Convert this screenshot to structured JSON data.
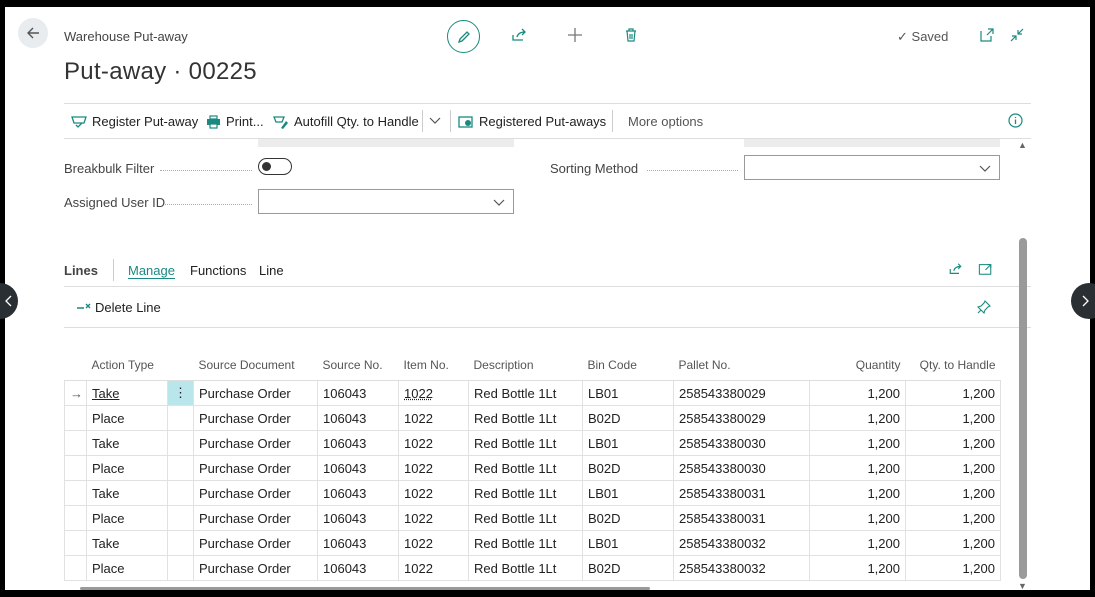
{
  "header": {
    "breadcrumb": "Warehouse Put-away",
    "title": "Put-away · 00225",
    "status": "Saved"
  },
  "toolbar": {
    "register_label": "Register Put-away",
    "print_label": "Print...",
    "autofill_label": "Autofill Qty. to Handle",
    "registered_label": "Registered Put-aways",
    "more_label": "More options"
  },
  "fields": {
    "breakbulk_label": "Breakbulk Filter",
    "assigned_label": "Assigned User ID",
    "sorting_label": "Sorting Method",
    "assigned_value": "",
    "sorting_value": "",
    "breakbulk_value": false
  },
  "lines": {
    "title": "Lines",
    "tabs": [
      "Manage",
      "Functions",
      "Line"
    ],
    "delete_label": "Delete Line",
    "columns": [
      "Action Type",
      "Source Document",
      "Source No.",
      "Item No.",
      "Description",
      "Bin Code",
      "Pallet No.",
      "Quantity",
      "Qty. to Handle"
    ],
    "rows": [
      [
        "Take",
        "Purchase Order",
        "106043",
        "1022",
        "Red Bottle 1Lt",
        "LB01",
        "258543380029",
        "1,200",
        "1,200"
      ],
      [
        "Place",
        "Purchase Order",
        "106043",
        "1022",
        "Red Bottle 1Lt",
        "B02D",
        "258543380029",
        "1,200",
        "1,200"
      ],
      [
        "Take",
        "Purchase Order",
        "106043",
        "1022",
        "Red Bottle 1Lt",
        "LB01",
        "258543380030",
        "1,200",
        "1,200"
      ],
      [
        "Place",
        "Purchase Order",
        "106043",
        "1022",
        "Red Bottle 1Lt",
        "B02D",
        "258543380030",
        "1,200",
        "1,200"
      ],
      [
        "Take",
        "Purchase Order",
        "106043",
        "1022",
        "Red Bottle 1Lt",
        "LB01",
        "258543380031",
        "1,200",
        "1,200"
      ],
      [
        "Place",
        "Purchase Order",
        "106043",
        "1022",
        "Red Bottle 1Lt",
        "B02D",
        "258543380031",
        "1,200",
        "1,200"
      ],
      [
        "Take",
        "Purchase Order",
        "106043",
        "1022",
        "Red Bottle 1Lt",
        "LB01",
        "258543380032",
        "1,200",
        "1,200"
      ],
      [
        "Place",
        "Purchase Order",
        "106043",
        "1022",
        "Red Bottle 1Lt",
        "B02D",
        "258543380032",
        "1,200",
        "1,200"
      ]
    ]
  },
  "colors": {
    "accent": "#1a8a80",
    "selected_cell": "#b8e6ea"
  }
}
